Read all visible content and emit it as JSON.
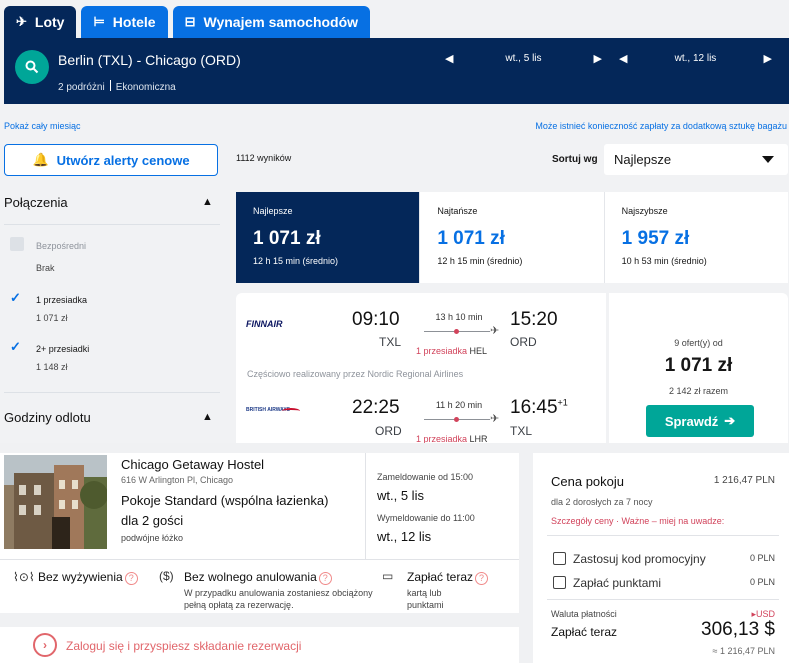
{
  "tabs": [
    {
      "label": "Loty",
      "icon": "plane-icon",
      "glyph": "✈"
    },
    {
      "label": "Hotele",
      "icon": "bed-icon",
      "glyph": "🛏"
    },
    {
      "label": "Wynajem samochodów",
      "icon": "car-icon",
      "glyph": "🚘"
    }
  ],
  "search": {
    "route": "Berlin (TXL) - Chicago (ORD)",
    "travellers": "2 podróżni",
    "cabin": "Ekonomiczna",
    "depart_date": "wt., 5 lis",
    "return_date": "wt., 12 lis"
  },
  "links": {
    "whole_month": "Pokaż cały miesiąc",
    "baggage_note": "Może istnieć konieczność zapłaty za dodatkową sztukę bagażu"
  },
  "alert_button": "Utwórz alerty cenowe",
  "results": {
    "count": "1112 wyników",
    "sort_label": "Sortuj wg",
    "sort_value": "Najlepsze"
  },
  "filters": {
    "connections_title": "Połączenia",
    "options": [
      {
        "label": "Bezpośredni",
        "sub": "Brak",
        "checked": false
      },
      {
        "label": "1 przesiadka",
        "sub": "1 071 zł",
        "checked": true
      },
      {
        "label": "2+ przesiadki",
        "sub": "1 148 zł",
        "checked": true
      }
    ],
    "departure_title": "Godziny odlotu"
  },
  "sort_cards": [
    {
      "label": "Najlepsze",
      "price": "1 071 zł",
      "duration": "12 h 15 min (średnio)"
    },
    {
      "label": "Najtańsze",
      "price": "1 071 zł",
      "duration": "12 h 15 min (średnio)"
    },
    {
      "label": "Najszybsze",
      "price": "1 957 zł",
      "duration": "10 h 53 min (średnio)"
    }
  ],
  "ticket": {
    "legs": [
      {
        "airline": "FINNAIR",
        "dep_time": "09:10",
        "dep_code": "TXL",
        "duration": "13 h 10 min",
        "stops": "1 przesiadka",
        "via": "HEL",
        "arr_time": "15:20",
        "arr_code": "ORD",
        "day_offset": ""
      },
      {
        "airline": "BRITISH AIRWAYS",
        "dep_time": "22:25",
        "dep_code": "ORD",
        "duration": "11 h 20 min",
        "stops": "1 przesiadka",
        "via": "LHR",
        "arr_time": "16:45",
        "arr_code": "TXL",
        "day_offset": "+1"
      }
    ],
    "operated_note": "Częściowo realizowany przez Nordic Regional Airlines",
    "offers": "9 ofert(y) od",
    "price": "1 071 zł",
    "total": "2 142 zł razem",
    "cta": "Sprawdź"
  },
  "hotel": {
    "name": "Chicago Getaway Hostel",
    "address": "616 W Arlington Pl, Chicago",
    "room": "Pokoje Standard (wspólna łazienka)",
    "guests": "dla 2 gości",
    "bed": "podwójne łóżko",
    "checkin_label": "Zameldowanie od 15:00",
    "checkin_date": "wt., 5 lis",
    "checkout_label": "Wymeldowanie do 11:00",
    "checkout_date": "wt., 12 lis",
    "features": [
      {
        "icon": "meal-icon",
        "glyph": "🍴",
        "label": "Bez wyżywienia",
        "sub": ""
      },
      {
        "icon": "money-icon",
        "glyph": "$",
        "label": "Bez wolnego anulowania",
        "sub": "W przypadku anulowania zostaniesz obciążony pełną opłatą za rezerwację."
      },
      {
        "icon": "wallet-icon",
        "glyph": "▭",
        "label": "Zapłać teraz",
        "sub": "kartą lub punktami"
      }
    ],
    "login_prompt": "Zaloguj się i przyspiesz składanie rezerwacji"
  },
  "price_panel": {
    "title": "Cena pokoju",
    "room_price": "1 216,47 PLN",
    "sub": "dla 2 dorosłych  za 7 nocy",
    "details_link": "Szczegóły ceny",
    "important": "Ważne – miej na uwadze:",
    "promo_label": "Zastosuj kod promocyjny",
    "promo_value": "0 PLN",
    "points_label": "Zapłać punktami",
    "points_value": "0 PLN",
    "currency_label": "Waluta płatności",
    "currency_value": "USD",
    "pay_now_label": "Zapłać teraz",
    "pay_now_value": "306,13 $",
    "converted": "≈ 1 216,47 PLN"
  }
}
